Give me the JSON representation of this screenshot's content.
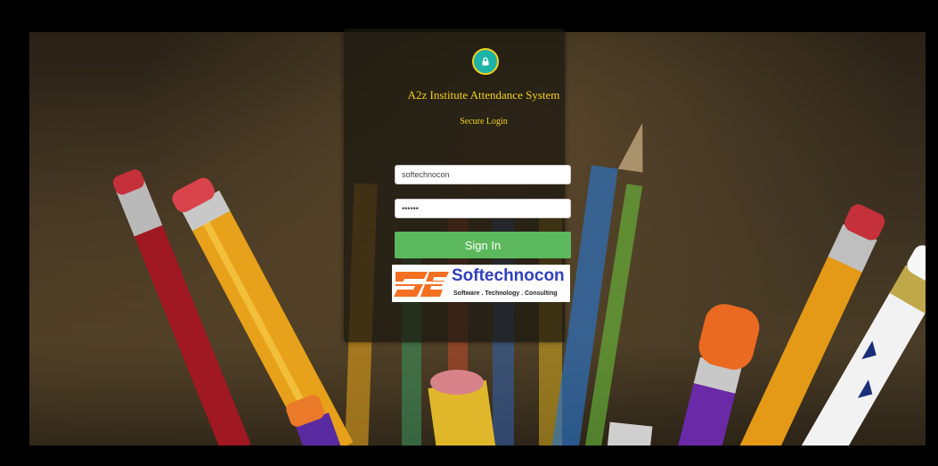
{
  "login": {
    "title": "A2z Institute Attendance System",
    "subtitle": "Secure Login",
    "username_value": "softechnocon",
    "password_value": "••••••",
    "signin_label": "Sign In"
  },
  "brand": {
    "logo_mark": "SE",
    "name": "Softechnocon",
    "tagline": "Software . Technology . Consulting"
  },
  "icons": {
    "lock": "lock-icon"
  },
  "colors": {
    "accent_yellow": "#f2d21b",
    "badge_teal": "#1fb2a6",
    "signin_green": "#5cb85c",
    "brand_blue": "#3040c0",
    "logo_orange": "#f36f21"
  }
}
